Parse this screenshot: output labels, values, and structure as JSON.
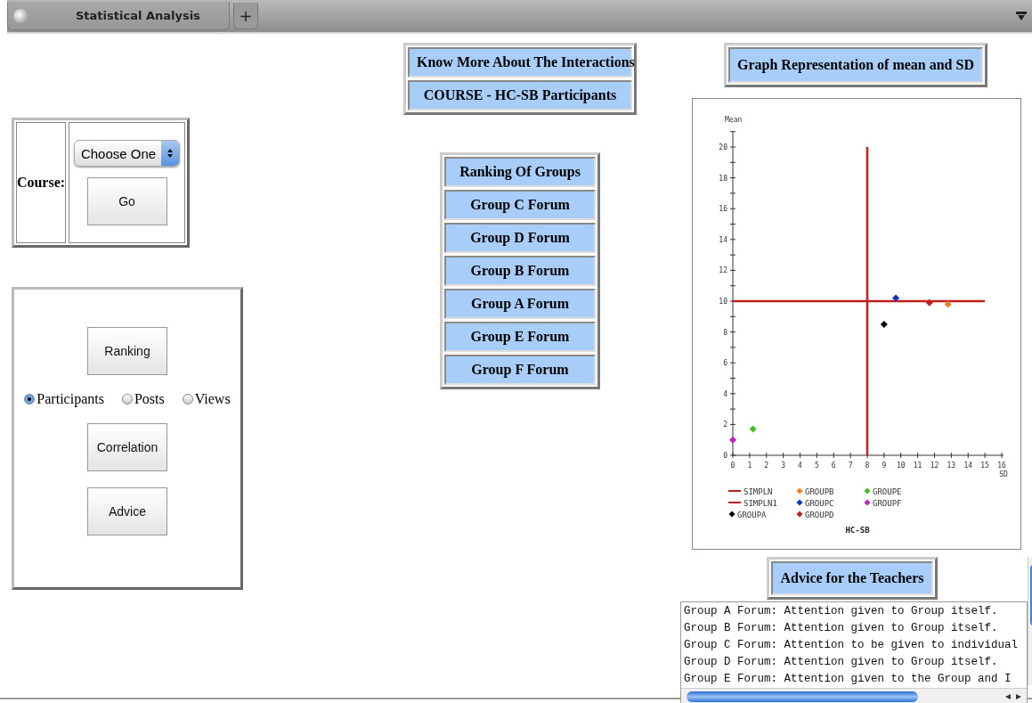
{
  "tab_bar": {
    "tabs": [
      {
        "label": "Statistical Analysis",
        "selected": true
      }
    ],
    "new_tab": "+"
  },
  "course_form": {
    "label": "Course:",
    "select": {
      "value": "Choose One"
    },
    "button": "Go"
  },
  "actions": {
    "items": [
      {
        "kind": "button",
        "label": "Ranking"
      },
      {
        "kind": "radios",
        "options": [
          {
            "label": "Participants",
            "selected": true
          },
          {
            "label": "Posts",
            "selected": false
          },
          {
            "label": "Views",
            "selected": false
          }
        ]
      },
      {
        "kind": "button",
        "label": "Correlation"
      },
      {
        "kind": "button",
        "label": "Advice"
      }
    ]
  },
  "interactions": {
    "rows": [
      "Know More About The Interactions",
      "COURSE - HC-SB Participants"
    ]
  },
  "ranking": {
    "rows": [
      "Ranking Of Groups",
      "Group C Forum",
      "Group D Forum",
      "Group B Forum",
      "Group A Forum",
      "Group E Forum",
      "Group F Forum"
    ]
  },
  "graph": {
    "title": "Graph Representation of mean and SD",
    "chart_data": {
      "type": "scatter",
      "title": "HC-SB",
      "xlabel": "SD",
      "ylabel": "Mean",
      "xlim": [
        0,
        16
      ],
      "ylim": [
        0,
        20
      ],
      "xticks": [
        0,
        1,
        2,
        3,
        4,
        5,
        6,
        7,
        8,
        9,
        10,
        11,
        12,
        13,
        14,
        15,
        16
      ],
      "yticks": [
        0,
        2,
        4,
        6,
        8,
        10,
        12,
        14,
        16,
        18,
        20
      ],
      "series": [
        {
          "name": "GROUPA",
          "color": "#000000",
          "x": [
            9
          ],
          "values": [
            8.5
          ]
        },
        {
          "name": "GROUPB",
          "color": "#f08020",
          "x": [
            12.8
          ],
          "values": [
            9.8
          ]
        },
        {
          "name": "GROUPC",
          "color": "#1030c0",
          "x": [
            9.7
          ],
          "values": [
            10.2
          ]
        },
        {
          "name": "GROUPD",
          "color": "#c02020",
          "x": [
            11.7
          ],
          "values": [
            9.9
          ]
        },
        {
          "name": "GROUPE",
          "color": "#40c020",
          "x": [
            1.2
          ],
          "values": [
            1.7
          ]
        },
        {
          "name": "GROUPF",
          "color": "#c020c0",
          "x": [
            0
          ],
          "values": [
            1
          ]
        }
      ],
      "ref_lines": [
        {
          "axis": "y",
          "value": 10,
          "label": "SIMPLN",
          "color": "#c0201c"
        },
        {
          "axis": "x",
          "value": 8,
          "label": "SIMPLN1",
          "color": "#c0201c"
        }
      ],
      "legend": "bottom"
    }
  },
  "advice": {
    "title": "Advice for the Teachers",
    "lines": [
      "Group A Forum: Attention given to Group itself.",
      "Group B Forum: Attention given to Group itself.",
      "Group C Forum: Attention to be given to individual",
      "Group D Forum: Attention given to Group itself.",
      "Group E Forum: Attention given to the Group and I"
    ]
  }
}
